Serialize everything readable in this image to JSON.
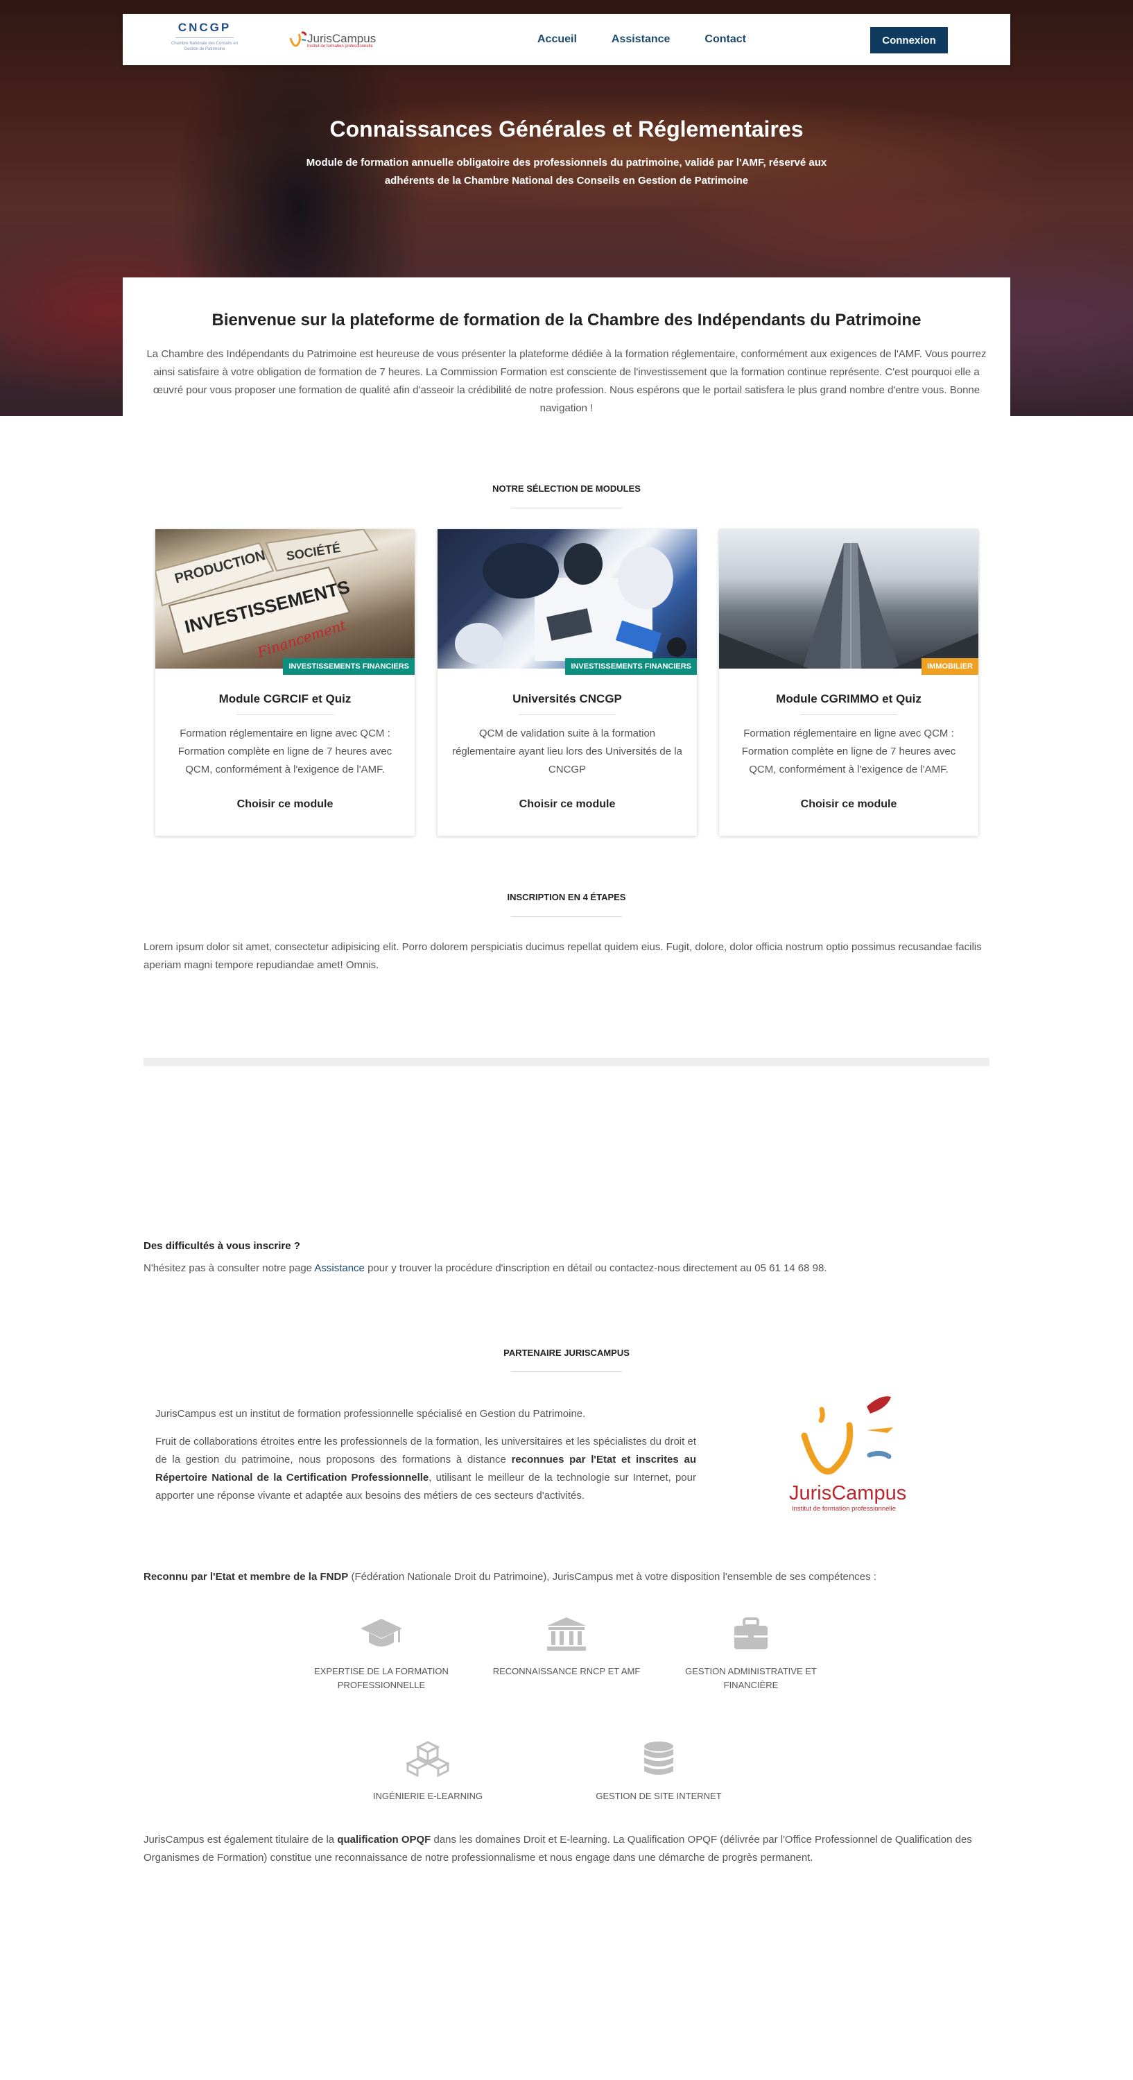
{
  "header": {
    "logo_cncgp": "CNCGP",
    "logo_cncgp_sub": "Chambre Nationale des Conseils en Gestion de Patrimoine",
    "logo_juriscampus": "JurisCampus",
    "logo_juriscampus_tag": "Institut de formation professionnelle",
    "nav": [
      "Accueil",
      "Assistance",
      "Contact"
    ],
    "login_label": "Connexion"
  },
  "hero": {
    "title": "Connaissances Générales et Réglementaires",
    "subtitle": "Module de formation annuelle obligatoire des professionnels du patrimoine, validé par l'AMF, réservé aux adhérents de la Chambre National des Conseils en Gestion de Patrimoine"
  },
  "welcome": {
    "title": "Bienvenue sur la plateforme de formation de la Chambre des Indépendants du Patrimoine",
    "text": "La Chambre des Indépendants du Patrimoine est heureuse de vous présenter la plateforme dédiée à la formation réglementaire, conformément aux exigences de l'AMF. Vous pourrez ainsi satisfaire à votre obligation de formation de 7 heures. La Commission Formation est consciente de l'investissement que la formation continue représente. C'est pourquoi elle a œuvré pour vous proposer une formation de qualité afin d'asseoir la crédibilité de notre profession. Nous espérons que le portail satisfera le plus grand nombre d'entre vous. Bonne navigation !"
  },
  "modules_section": {
    "title": "NOTRE SÉLECTION DE MODULES",
    "cards": [
      {
        "badge": "INVESTISSEMENTS FINANCIERS",
        "badge_color": "#0d8f80",
        "title": "Module CGRCIF et Quiz",
        "text": "Formation réglementaire en ligne avec QCM : Formation complète en ligne de 7 heures avec QCM, conformément à l'exigence de l'AMF.",
        "cta": "Choisir ce module",
        "image_words": [
          "PRODUCTION",
          "SOCIÉTÉ",
          "INVESTISSEMENTS",
          "Financement"
        ]
      },
      {
        "badge": "INVESTISSEMENTS FINANCIERS",
        "badge_color": "#0d8f80",
        "title": "Universités CNCGP",
        "text": "QCM de validation suite à la formation réglementaire ayant lieu lors des Universités de la CNCGP",
        "cta": "Choisir ce module"
      },
      {
        "badge": "IMMOBILIER",
        "badge_color": "#f0a020",
        "title": "Module CGRIMMO et Quiz",
        "text": "Formation réglementaire en ligne avec QCM : Formation complète en ligne de 7 heures avec QCM, conformément à l'exigence de l'AMF.",
        "cta": "Choisir ce module"
      }
    ]
  },
  "inscription": {
    "title": "INSCRIPTION EN 4 ÉTAPES",
    "text": "Lorem ipsum dolor sit amet, consectetur adipisicing elit. Porro dolorem perspiciatis ducimus repellat quidem eius. Fugit, dolore, dolor officia nostrum optio possimus recusandae facilis aperiam magni tempore repudiandae amet! Omnis."
  },
  "help": {
    "title": "Des difficultés à vous inscrire ?",
    "text_before": "N'hésitez pas à consulter notre page ",
    "link": "Assistance",
    "text_after": " pour y trouver la procédure d'inscription en détail ou contactez-nous directement au 05 61 14 68 98."
  },
  "partner": {
    "title": "PARTENAIRE JURISCAMPUS",
    "intro": "JurisCampus est un institut de formation professionnelle spécialisé en Gestion du Patrimoine.",
    "p2_a": "Fruit de collaborations étroites entre les professionnels de la formation, les universitaires et les spécialistes du droit et de la gestion du patrimoine, nous proposons des formations à distance ",
    "p2_b": "reconnues par l'Etat et inscrites au Répertoire National de la Certification Professionnelle",
    "p2_c": ", utilisant le meilleur de la technologie sur Internet, pour apporter une réponse vivante et adaptée aux besoins des métiers de ces secteurs d'activités.",
    "logo_name": "JurisCampus",
    "logo_tag": "Institut de formation professionnelle",
    "recognized_a": "Reconnu par l'Etat et membre de la FNDP",
    "recognized_b": " (Fédération Nationale Droit du Patrimoine), JurisCampus met à votre disposition l'ensemble de ses compétences :",
    "features": [
      {
        "icon": "graduation-cap-icon",
        "label": "EXPERTISE DE LA FORMATION PROFESSIONNELLE"
      },
      {
        "icon": "institution-icon",
        "label": "RECONNAISSANCE RNCP ET AMF"
      },
      {
        "icon": "briefcase-icon",
        "label": "GESTION ADMINISTRATIVE ET FINANCIÈRE"
      },
      {
        "icon": "cubes-icon",
        "label": "INGÉNIERIE E-LEARNING"
      },
      {
        "icon": "database-icon",
        "label": "GESTION DE SITE INTERNET"
      }
    ],
    "opqf_a": "JurisCampus est également titulaire de la ",
    "opqf_b": "qualification OPQF",
    "opqf_c": " dans les domaines Droit et E-learning. La Qualification OPQF (délivrée par l'Office Professionnel de Qualification des Organismes de Formation) constitue une reconnaissance de notre professionnalisme et nous engage dans une démarche de progrès permanent."
  },
  "colors": {
    "navy": "#0e3b5f",
    "teal_badge": "#0d8f80",
    "orange_badge": "#f0a020",
    "juriscampus_red": "#c2262e",
    "icon_grey": "#bfbfbf"
  }
}
